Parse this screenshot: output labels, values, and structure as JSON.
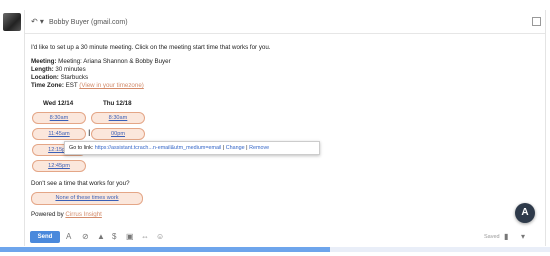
{
  "to_field": {
    "recipient": "Bobby Buyer (gmail.com)"
  },
  "body": {
    "intro": "I'd like to set up a 30 minute meeting. Click on the meeting start time that works for you.",
    "meeting_label": "Meeting:",
    "meeting_value": "Meeting: Ariana Shannon & Bobby Buyer",
    "length_label": "Length:",
    "length_value": "30 minutes",
    "location_label": "Location:",
    "location_value": "Starbucks",
    "timezone_label": "Time Zone:",
    "timezone_value": "EST",
    "timezone_link": "(View in your timezone)"
  },
  "schedule": {
    "day1": {
      "label": "Wed 12/14",
      "slots": [
        "8:30am",
        "11:45am",
        "12:15pm",
        "12:45pm"
      ]
    },
    "day2": {
      "label": "Thu 12/18",
      "slots": [
        "8:30am",
        "00pm"
      ]
    }
  },
  "link_tooltip": {
    "prefix": "Go to link:",
    "url": "https://assistant.tcrach...n-email&utm_medium=email",
    "change": "Change",
    "sep": "|",
    "remove": "Remove"
  },
  "footer": {
    "question": "Don't see a time that works for you?",
    "none_button": "None of these times work",
    "powered_prefix": "Powered by",
    "powered_link": "Cirrus Insight"
  },
  "fab": {
    "letter": "A"
  },
  "toolbar": {
    "send": "Send",
    "saved": "Saved"
  },
  "upload_progress": 0.6
}
